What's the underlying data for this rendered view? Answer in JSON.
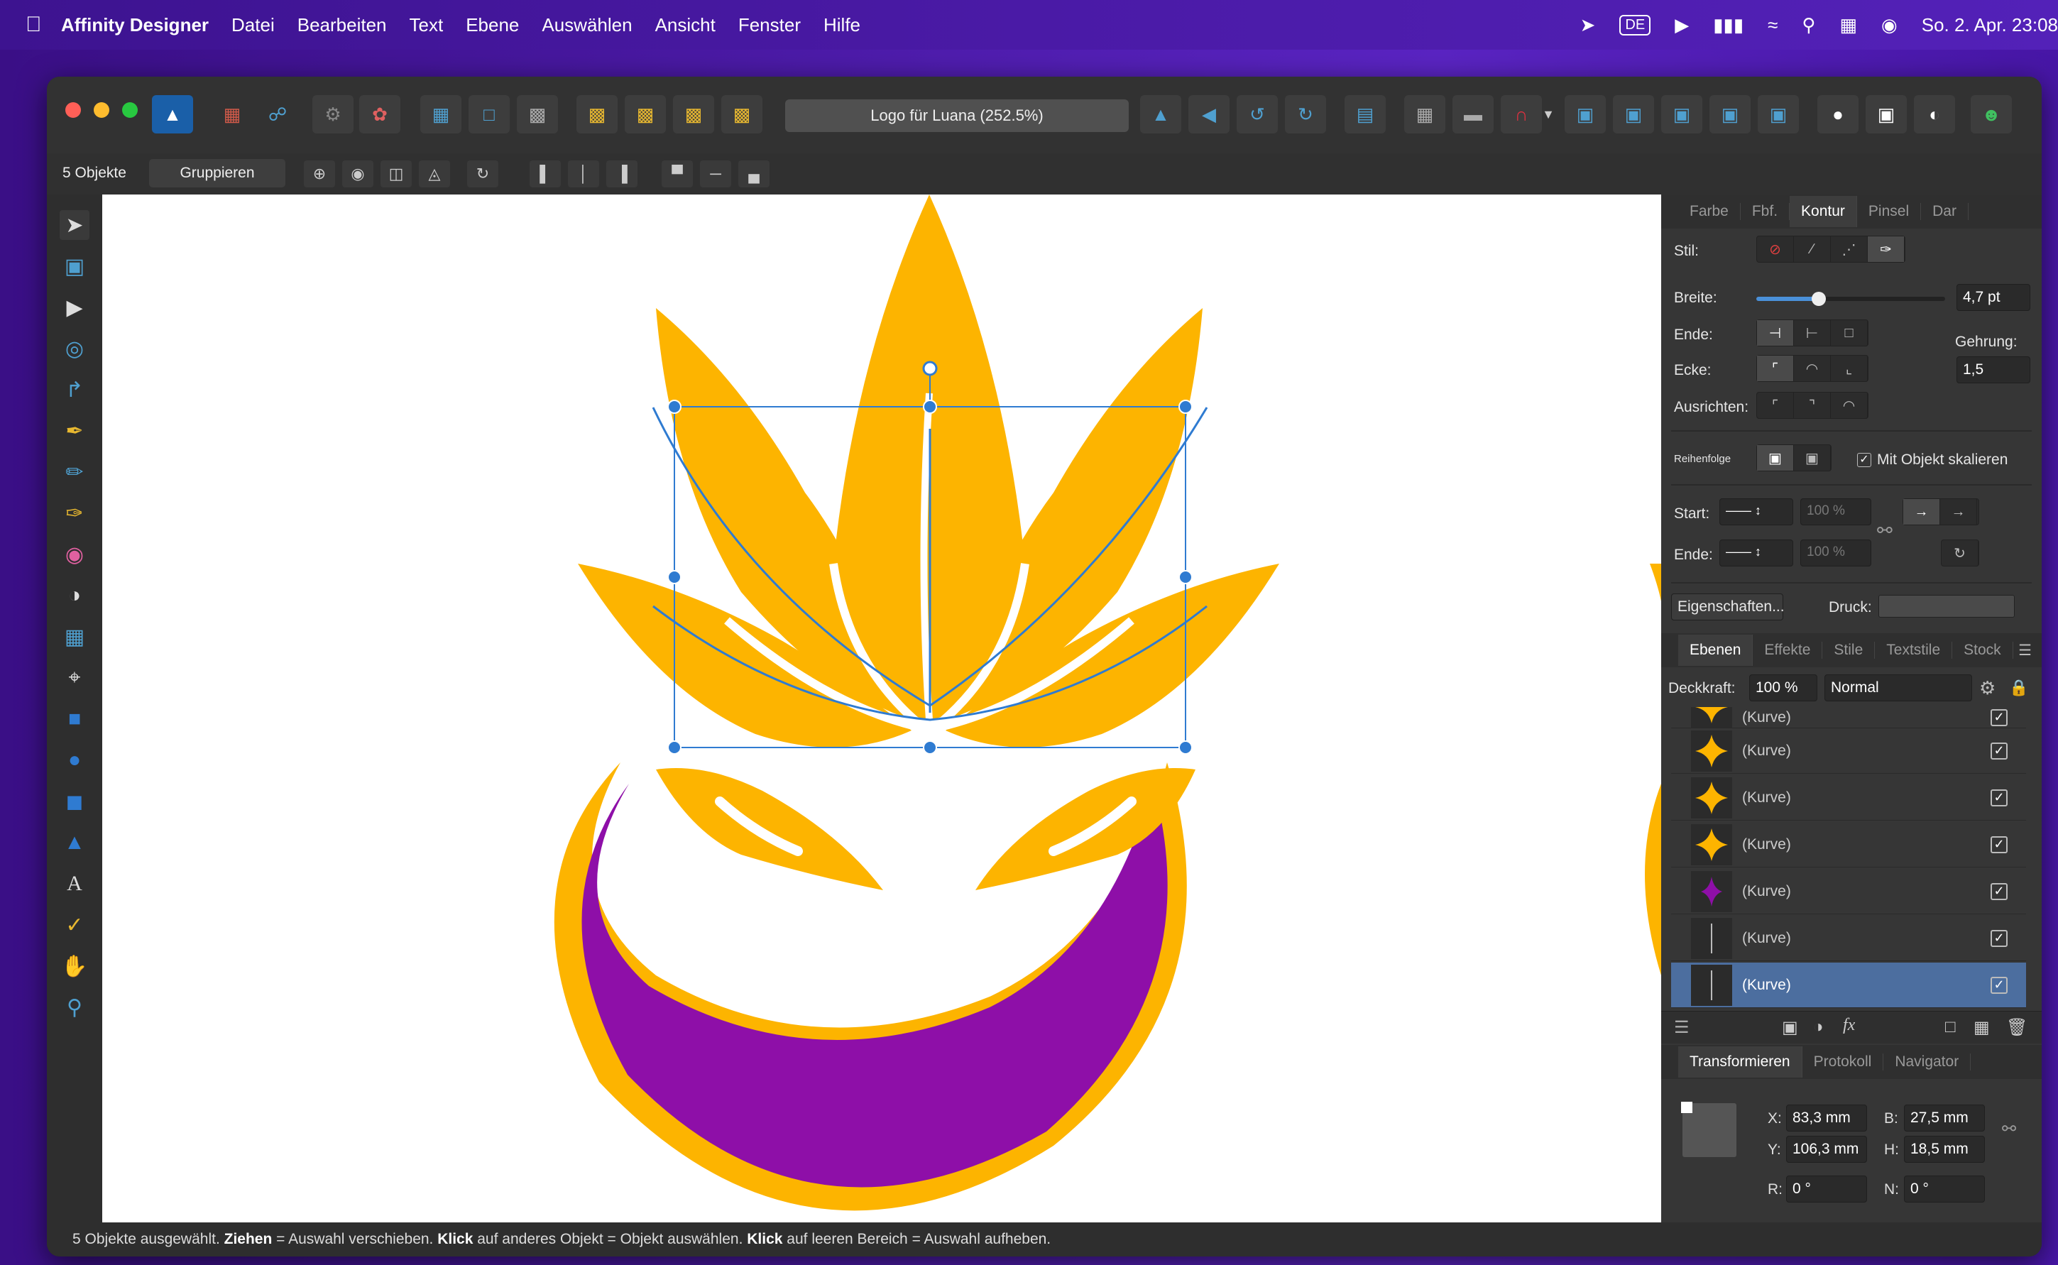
{
  "menubar": {
    "app_name": "Affinity Designer",
    "items": [
      "Datei",
      "Bearbeiten",
      "Text",
      "Ebene",
      "Auswählen",
      "Ansicht",
      "Fenster",
      "Hilfe"
    ],
    "input_source": "DE",
    "clock": "So. 2. Apr.  23:08"
  },
  "window": {
    "doc_title": "Logo für Luana (252.5%)"
  },
  "context": {
    "selection_count": "5 Objekte",
    "group_label": "Gruppieren"
  },
  "stroke_panel": {
    "tabs": [
      "Farbe",
      "Fbf.",
      "Kontur",
      "Pinsel",
      "Dar"
    ],
    "active_tab": "Kontur",
    "style_label": "Stil:",
    "width_label": "Breite:",
    "width_value": "4,7 pt",
    "width_slider_fraction": 0.33,
    "cap_label": "Ende:",
    "join_label": "Ecke:",
    "miter_label": "Gehrung:",
    "miter_value": "1,5",
    "align_label": "Ausrichten:",
    "order_label": "Reihenfolge",
    "scale_with_object": "Mit Objekt skalieren",
    "start_label": "Start:",
    "end_label": "Ende:",
    "start_pct": "100 %",
    "end_pct": "100 %",
    "properties_button": "Eigenschaften...",
    "pressure_label": "Druck:"
  },
  "layers_panel": {
    "tabs": [
      "Ebenen",
      "Effekte",
      "Stile",
      "Textstile",
      "Stock"
    ],
    "active_tab": "Ebenen",
    "opacity_label": "Deckkraft:",
    "opacity_value": "100 %",
    "blend_mode": "Normal",
    "rows": [
      {
        "name": "(Kurve)",
        "thumb": "star-orange"
      },
      {
        "name": "(Kurve)",
        "thumb": "star-orange"
      },
      {
        "name": "(Kurve)",
        "thumb": "star-orange"
      },
      {
        "name": "(Kurve)",
        "thumb": "star-orange"
      },
      {
        "name": "(Kurve)",
        "thumb": "star-purple"
      },
      {
        "name": "(Kurve)",
        "thumb": "line"
      },
      {
        "name": "(Kurve)",
        "thumb": "line"
      }
    ]
  },
  "transform_panel": {
    "tabs": [
      "Transformieren",
      "Protokoll",
      "Navigator"
    ],
    "active_tab": "Transformieren",
    "x_label": "X:",
    "x_value": "83,3 mm",
    "y_label": "Y:",
    "y_value": "106,3 mm",
    "b_label": "B:",
    "b_value": "27,5 mm",
    "h_label": "H:",
    "h_value": "18,5 mm",
    "r_label": "R:",
    "r_value": "0 °",
    "n_label": "N:",
    "n_value": "0 °"
  },
  "statusbar": {
    "part1": "5 Objekte ausgewählt. ",
    "bold1": "Ziehen",
    "part2": " = Auswahl verschieben. ",
    "bold2": "Klick",
    "part3": " auf anderes Objekt = Objekt auswählen. ",
    "bold3": "Klick",
    "part4": " auf leeren Bereich = Auswahl aufheben."
  },
  "colors": {
    "orange": "#FDB400",
    "purple": "#8E0FA8",
    "selection_blue": "#2F7BD1"
  }
}
